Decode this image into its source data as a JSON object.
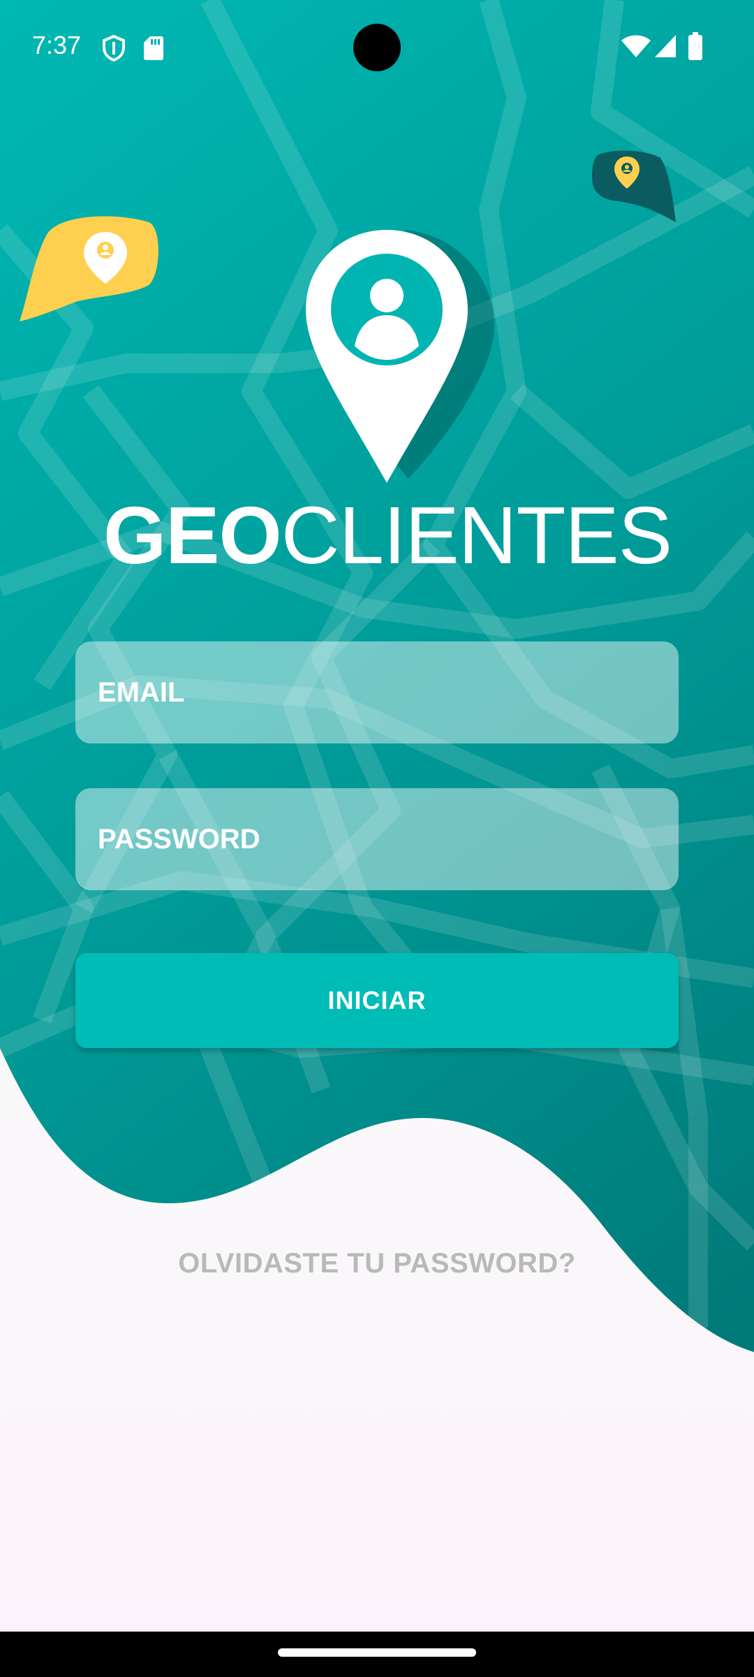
{
  "status_bar": {
    "time": "7:37",
    "left_icons": [
      "shield-icon",
      "sd-card-icon"
    ],
    "right_icons": [
      "wifi-icon",
      "cell-signal-icon",
      "battery-icon"
    ]
  },
  "logo": {
    "icon": "location-person-pin-icon",
    "title_bold": "GEO",
    "title_light": "CLIENTES"
  },
  "form": {
    "email_placeholder": "EMAIL",
    "email_value": "",
    "password_placeholder": "PASSWORD",
    "password_value": "",
    "submit_label": "INICIAR"
  },
  "forgot_password_label": "OLVIDASTE TU PASSWORD?",
  "colors": {
    "teal_dark": "#007c7c",
    "teal_light": "#00b5b1",
    "accent": "#00bcb7",
    "yellow": "#ffcf4f",
    "forgot_text": "#b9b9b9"
  }
}
